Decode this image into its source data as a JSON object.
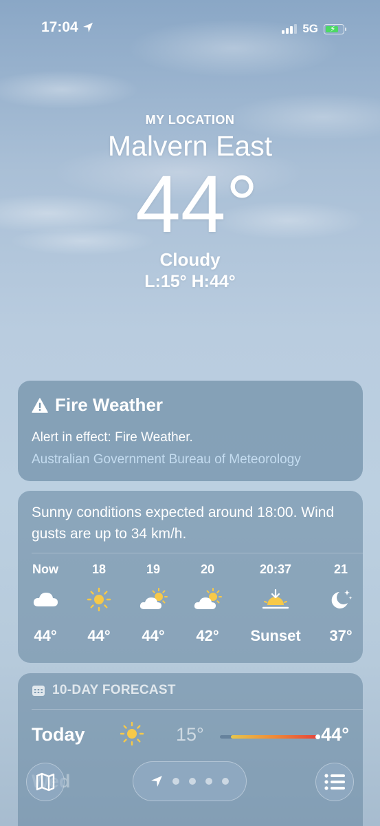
{
  "status_bar": {
    "time": "17:04",
    "network": "5G",
    "battery_fraction": 0.65
  },
  "header": {
    "label": "MY LOCATION",
    "city": "Malvern East",
    "temperature": "44°",
    "condition": "Cloudy",
    "low_high": "L:15° H:44°"
  },
  "alert": {
    "title": "Fire Weather",
    "text": "Alert in effect: Fire Weather.",
    "source": "Australian Government Bureau of Meteorology",
    "icon": "warning-triangle-icon"
  },
  "hourly": {
    "summary": "Sunny conditions expected around 18:00. Wind gusts are up to 34 km/h.",
    "items": [
      {
        "time": "Now",
        "icon": "cloud-icon",
        "temp": "44°"
      },
      {
        "time": "18",
        "icon": "sun-icon",
        "temp": "44°"
      },
      {
        "time": "19",
        "icon": "partly-sunny-icon",
        "temp": "44°"
      },
      {
        "time": "20",
        "icon": "partly-sunny-icon",
        "temp": "42°"
      },
      {
        "time": "20:37",
        "icon": "sunset-icon",
        "temp": "Sunset"
      },
      {
        "time": "21",
        "icon": "moon-stars-icon",
        "temp": "37°"
      }
    ]
  },
  "forecast": {
    "header": "10-DAY FORECAST",
    "rows": [
      {
        "day": "Today",
        "icon": "sun-icon",
        "low": "15°",
        "high": "44°"
      }
    ],
    "next_partial": "Wed"
  },
  "toolbar": {
    "map_icon": "map-icon",
    "location_icon": "location-arrow-icon",
    "list_icon": "list-icon",
    "pages": 5
  },
  "colors": {
    "sun": "#f7c948",
    "temp_bar_start": "#e8c64a",
    "temp_bar_end": "#e6443a",
    "alert_source": "#c4dcf0"
  }
}
